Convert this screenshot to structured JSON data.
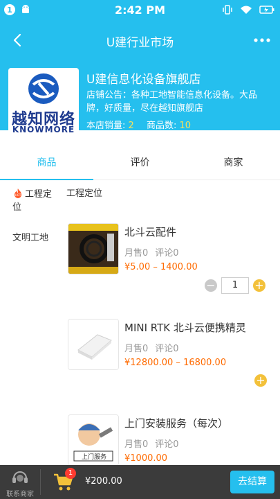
{
  "status_bar": {
    "notification_count": "1",
    "time": "2:42 PM"
  },
  "header": {
    "title": "U建行业市场",
    "icons": {
      "back": "back-arrow-icon",
      "more": "more-dots-icon"
    }
  },
  "store": {
    "logo_name": "越知网络",
    "logo_en": "KNOWMORE",
    "name": "U建信息化设备旗舰店",
    "notice_label": "店铺公告：",
    "notice_text": "各种工地智能信息化设备。大品牌，好质量，尽在越知旗舰店",
    "sales_label": "本店销量:",
    "sales_value": "2",
    "products_label": "商品数:",
    "products_value": "10"
  },
  "tabs": [
    {
      "label": "商品",
      "active": true
    },
    {
      "label": "评价",
      "active": false
    },
    {
      "label": "商家",
      "active": false
    }
  ],
  "categories": [
    {
      "label": "工程定位",
      "hot": true
    },
    {
      "label": "文明工地",
      "hot": false
    }
  ],
  "section_title": "工程定位",
  "products": [
    {
      "name": "北斗云配件",
      "sold": "月售0",
      "reviews": "评论0",
      "price": "¥5.00 – 1400.00",
      "quantity": "1"
    },
    {
      "name": "MINI RTK 北斗云便携精灵",
      "sold": "月售0",
      "reviews": "评论0",
      "price": "¥12800.00 – 16800.00"
    },
    {
      "name": "上门安装服务（每次）",
      "sold": "月售0",
      "reviews": "评论0",
      "price": "¥1000.00",
      "thumb_text": "上门服务"
    }
  ],
  "bottom_bar": {
    "contact_label": "联系商家",
    "cart_count": "1",
    "total": "¥200.00",
    "checkout_label": "去结算"
  },
  "colors": {
    "accent": "#25bfee",
    "price": "#ff6a00",
    "highlight": "#f7e25a",
    "add_button": "#f3c13a"
  }
}
